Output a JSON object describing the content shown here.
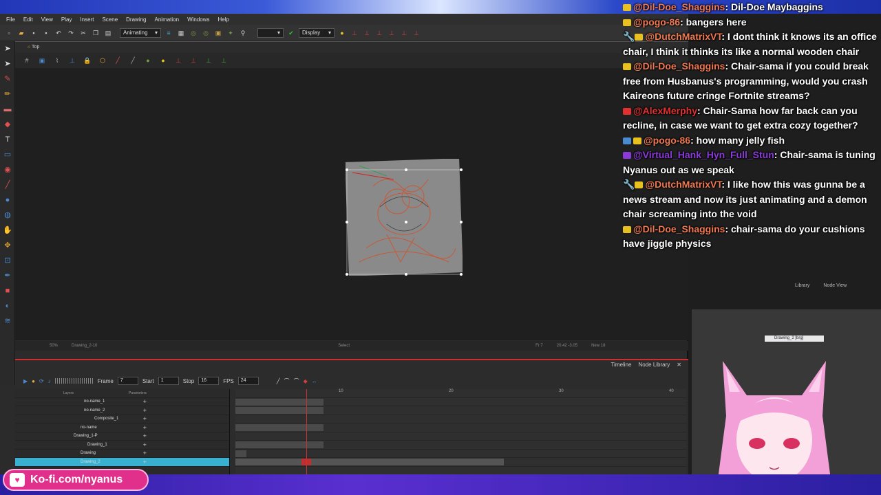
{
  "menu": [
    "File",
    "Edit",
    "View",
    "Play",
    "Insert",
    "Scene",
    "Drawing",
    "Animation",
    "Windows",
    "Help"
  ],
  "toolbar": {
    "mode_select": "Animating",
    "display_select": "Display"
  },
  "viewport": {
    "tab_label": "Top",
    "status_center": "Select",
    "status_left_zoom": "50%",
    "status_mid": "Drawing_2-10",
    "status_right_frame": "Fr 7",
    "status_right_coords": "20.42 -3.05",
    "status_right_new": "New 18"
  },
  "timeline": {
    "tabs": [
      "Timeline",
      "Node Library"
    ],
    "frame_label": "Frame",
    "frame_value": "7",
    "start_label": "Start",
    "start_value": "1",
    "stop_label": "Stop",
    "stop_value": "16",
    "fps_label": "FPS",
    "fps_value": "24",
    "layers_header": "Layers",
    "params_header": "Parameters",
    "ruler": [
      "10",
      "20",
      "30",
      "40"
    ],
    "layers": [
      "no-name_1",
      "no-name_2",
      "Composite_1",
      "no-name",
      "Drawing_1-P",
      "Drawing_1",
      "Drawing",
      "Drawing_2"
    ]
  },
  "chat": [
    {
      "user": "@Dil-Doe_Shaggins",
      "text": "Dil-Doe Maybaggins",
      "color": "#f07850"
    },
    {
      "user": "@pogo-86",
      "text": "bangers here",
      "color": "#f07850"
    },
    {
      "user": "@DutchMatrixVT",
      "text": "I dont think it knows its an office chair, I think it thinks its like a normal wooden chair",
      "color": "#f07850"
    },
    {
      "user": "@Dil-Doe_Shaggins",
      "text": "Chair-sama if you could break free from Husbanus's programming, would you crash Kaireons future cringe Fortnite streams?",
      "color": "#f07850"
    },
    {
      "user": "@AlexMerphy",
      "text": "Chair-Sama how far back can you recline, in case we want to get extra cozy together?",
      "color": "#e03030"
    },
    {
      "user": "@pogo-86",
      "text": "how many jelly fish",
      "color": "#f07850"
    },
    {
      "user": "@Virtual_Hank_Hyn_Full_Stun",
      "text": "Chair-sama is tuning Nyanus out as we speak",
      "color": "#8a3ad8"
    },
    {
      "user": "@DutchMatrixVT",
      "text": "I like how this was gunna be a news stream and now its just animating and a demon chair screaming into the void",
      "color": "#f07850"
    },
    {
      "user": "@Dil-Doe_Shaggins",
      "text": "chair-sama do your cushions have jiggle physics",
      "color": "#f07850"
    }
  ],
  "nodeview": {
    "node_label": "Drawing_2 [brg]",
    "tab_library": "Library",
    "tab_nodeview": "Node View"
  },
  "kofi": {
    "text": "Ko-fi.com/nyanus"
  }
}
